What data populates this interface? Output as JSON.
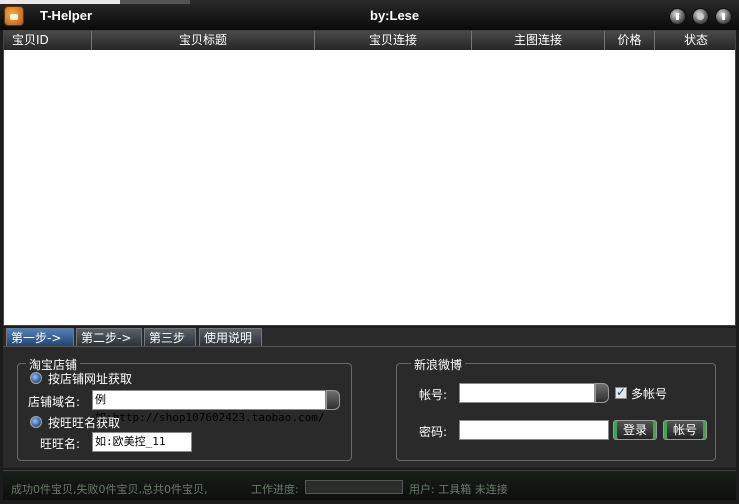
{
  "window": {
    "title": "T-Helper",
    "author": "by:Lese"
  },
  "table": {
    "columns": [
      "宝贝ID",
      "宝贝标题",
      "宝贝连接",
      "主图连接",
      "价格",
      "状态"
    ],
    "rows": []
  },
  "tabs": [
    "第一步->",
    "第二步->",
    "第三步",
    "使用说明"
  ],
  "shop": {
    "legend": "淘宝店铺",
    "by_url_label": "按店铺网址获取",
    "domain_label": "店铺域名:",
    "domain_value": "例如:http://shop107602423.taobao.com/",
    "by_wangwang_label": "按旺旺名获取",
    "wangwang_label": "旺旺名:",
    "wangwang_value": "如:欧美控_11"
  },
  "weibo": {
    "legend": "新浪微博",
    "account_label": "帐号:",
    "account_value": "",
    "multi_account_label": "多帐号",
    "password_label": "密码:",
    "password_value": "",
    "login_button": "登录",
    "account_button": "帐号"
  },
  "status": {
    "result_text": "成功0件宝贝,失败0件宝贝,总共0件宝贝,",
    "progress_label": "工作进度:",
    "progress_fraction": 0,
    "right_text": "用户: 工具箱 未连接"
  }
}
